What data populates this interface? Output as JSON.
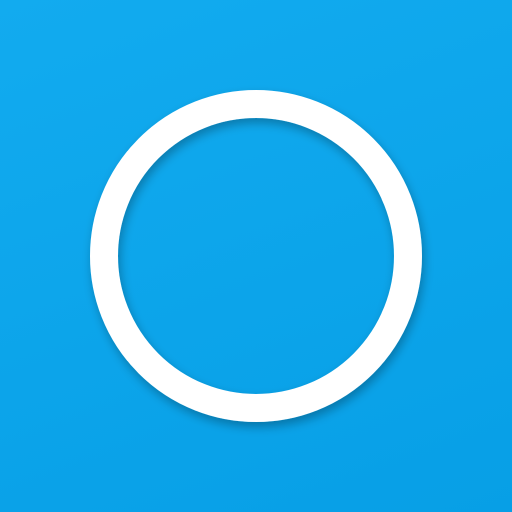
{
  "icon": {
    "name": "circle-ring-icon",
    "shape": "ring"
  },
  "colors": {
    "background": "#0ea5e9",
    "ring": "#ffffff",
    "shadow": "#0472a8"
  }
}
